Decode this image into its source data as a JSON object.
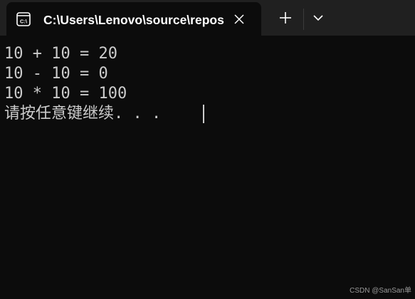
{
  "tab": {
    "title": "C:\\Users\\Lenovo\\source\\repos",
    "icon": "console-icon"
  },
  "toolbar": {
    "close_icon": "close-icon",
    "new_tab_icon": "plus-icon",
    "dropdown_icon": "chevron-down-icon"
  },
  "console": {
    "lines": [
      "10 + 10 = 20",
      "10 - 10 = 0",
      "10 * 10 = 100",
      "请按任意键继续. . ."
    ]
  },
  "watermark": "CSDN @SanSan单",
  "colors": {
    "background": "#0c0c0c",
    "titlebar": "#202020",
    "text": "#cccccc"
  }
}
